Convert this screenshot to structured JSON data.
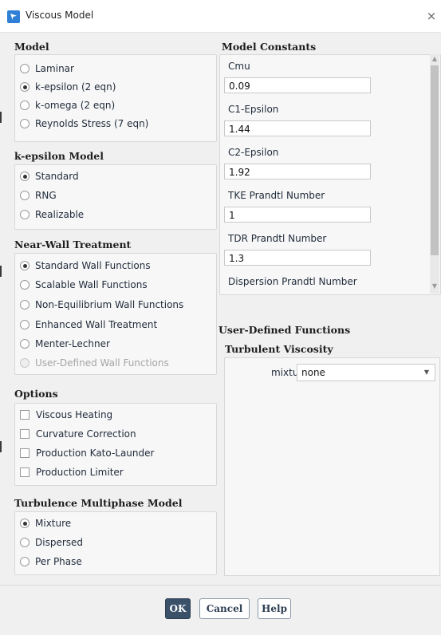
{
  "window": {
    "title": "Viscous Model",
    "icon": "fluent-app-icon",
    "close": "×"
  },
  "model": {
    "title": "Model",
    "options": [
      {
        "label": "Laminar",
        "selected": false
      },
      {
        "label": "k-epsilon (2 eqn)",
        "selected": true
      },
      {
        "label": "k-omega (2 eqn)",
        "selected": false
      },
      {
        "label": "Reynolds Stress (7 eqn)",
        "selected": false
      }
    ]
  },
  "kepsilon_model": {
    "title": "k-epsilon Model",
    "options": [
      {
        "label": "Standard",
        "selected": true
      },
      {
        "label": "RNG",
        "selected": false
      },
      {
        "label": "Realizable",
        "selected": false
      }
    ]
  },
  "near_wall": {
    "title": "Near-Wall Treatment",
    "options": [
      {
        "label": "Standard Wall Functions",
        "selected": true
      },
      {
        "label": "Scalable Wall Functions",
        "selected": false
      },
      {
        "label": "Non-Equilibrium Wall Functions",
        "selected": false
      },
      {
        "label": "Enhanced Wall Treatment",
        "selected": false
      },
      {
        "label": "Menter-Lechner",
        "selected": false
      },
      {
        "label": "User-Defined Wall Functions",
        "selected": false,
        "disabled": true
      }
    ]
  },
  "options": {
    "title": "Options",
    "checks": [
      {
        "label": "Viscous Heating",
        "checked": false
      },
      {
        "label": "Curvature Correction",
        "checked": false
      },
      {
        "label": "Production Kato-Launder",
        "checked": false
      },
      {
        "label": "Production Limiter",
        "checked": false
      }
    ]
  },
  "multiphase": {
    "title": "Turbulence Multiphase Model",
    "options": [
      {
        "label": "Mixture",
        "selected": true
      },
      {
        "label": "Dispersed",
        "selected": false
      },
      {
        "label": "Per Phase",
        "selected": false
      }
    ]
  },
  "constants": {
    "title": "Model Constants",
    "items": [
      {
        "label": "Cmu",
        "value": "0.09"
      },
      {
        "label": "C1-Epsilon",
        "value": "1.44"
      },
      {
        "label": "C2-Epsilon",
        "value": "1.92"
      },
      {
        "label": "TKE Prandtl Number",
        "value": "1"
      },
      {
        "label": "TDR Prandtl Number",
        "value": "1.3"
      },
      {
        "label": "Dispersion Prandtl Number"
      }
    ]
  },
  "udf": {
    "title": "User-Defined Functions",
    "subtitle": "Turbulent Viscosity",
    "mixture_label": "mixture",
    "mixture_value": "none"
  },
  "buttons": {
    "ok": "OK",
    "cancel": "Cancel",
    "help": "Help"
  },
  "colors": {
    "accent": "#3b5169",
    "panel": "#f7f7f7",
    "background": "#f0f0f0"
  }
}
